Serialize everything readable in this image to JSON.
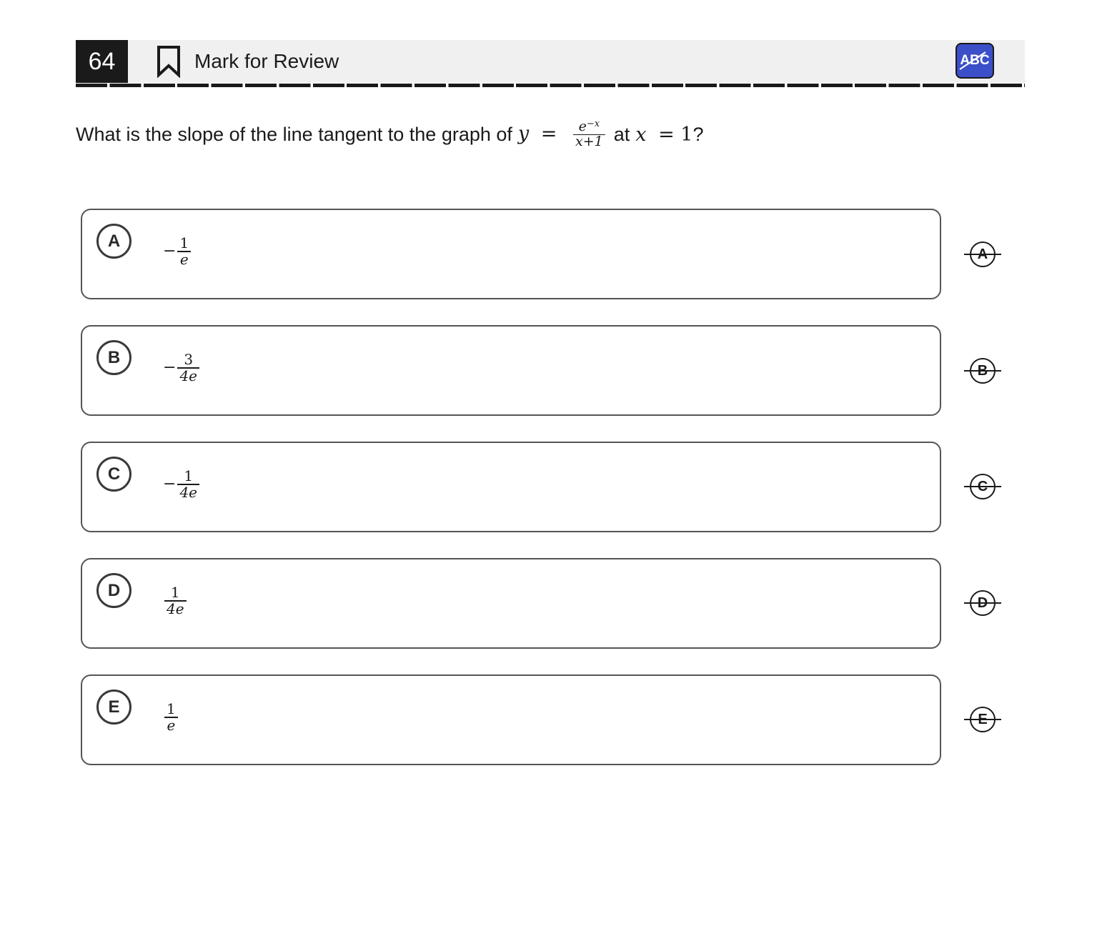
{
  "header": {
    "question_number": "64",
    "mark_label": "Mark for Review",
    "abc_label": "ABC",
    "accent_color": "#3b4fc8"
  },
  "question": {
    "prefix": "What is the slope of the line tangent to the graph of",
    "y_var": "y",
    "equals": "=",
    "numerator_base": "e",
    "numerator_exponent": "−x",
    "denominator": "x+1",
    "mid_text": "at",
    "x_var": "x",
    "x_value": "= 1",
    "suffix": "?"
  },
  "choices": [
    {
      "letter": "A",
      "sign": "−",
      "numerator": "1",
      "denominator": "e"
    },
    {
      "letter": "B",
      "sign": "−",
      "numerator": "3",
      "denominator": "4e"
    },
    {
      "letter": "C",
      "sign": "−",
      "numerator": "1",
      "denominator": "4e"
    },
    {
      "letter": "D",
      "sign": "",
      "numerator": "1",
      "denominator": "4e"
    },
    {
      "letter": "E",
      "sign": "",
      "numerator": "1",
      "denominator": "e"
    }
  ]
}
